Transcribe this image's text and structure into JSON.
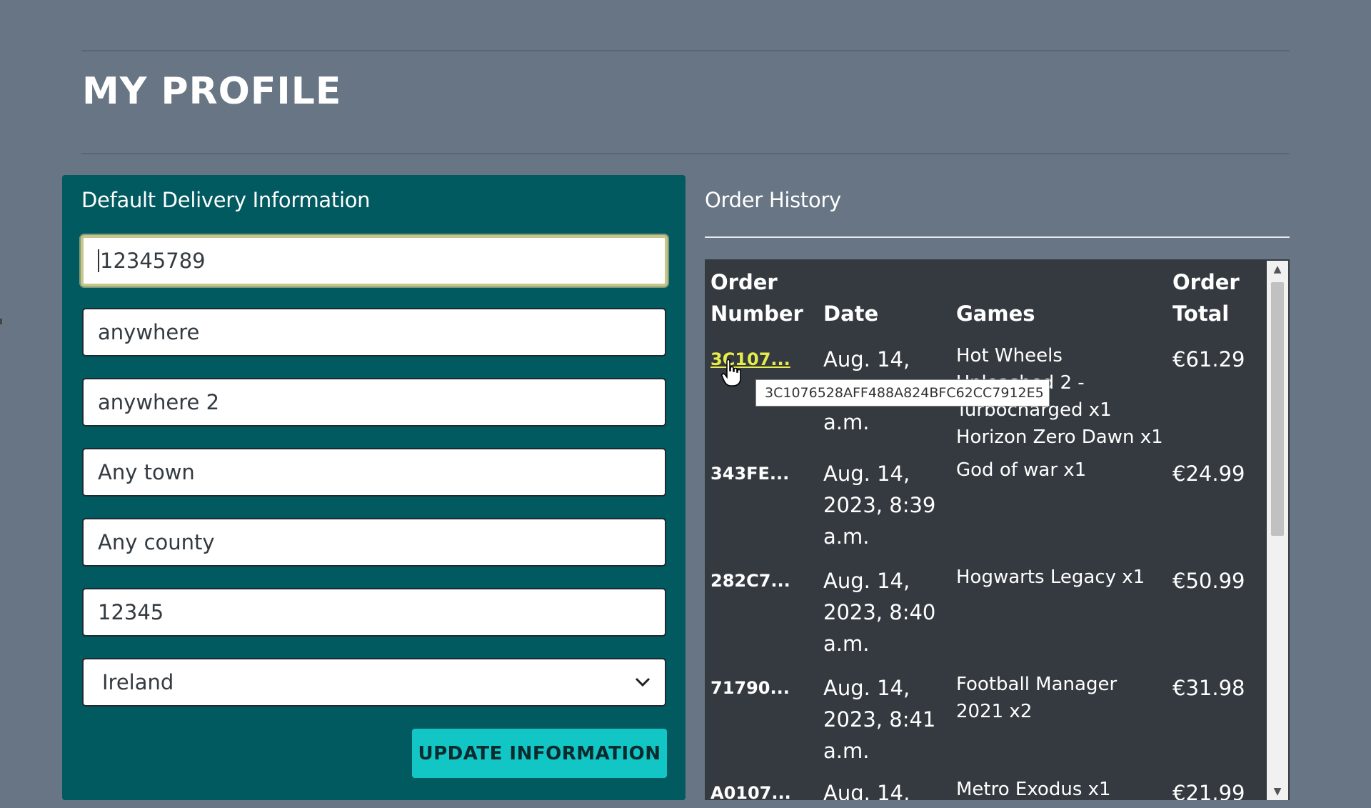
{
  "page": {
    "title": "MY PROFILE"
  },
  "delivery": {
    "heading": "Default Delivery Information",
    "phone": "12345789",
    "street1": "anywhere",
    "street2": "anywhere 2",
    "town": "Any town",
    "county": "Any county",
    "postcode": "12345",
    "country": "Ireland",
    "update_label": "UPDATE INFORMATION"
  },
  "history": {
    "heading": "Order History",
    "headers": {
      "order_number_1": "Order",
      "order_number_2": "Number",
      "date": "Date",
      "games": "Games",
      "total_1": "Order",
      "total_2": "Total"
    },
    "orders": [
      {
        "number": "3C107...",
        "date": "Aug. 14, 2023, 8:38 a.m.",
        "games": "Hot Wheels Unleashed 2 - Turbocharged x1 Horizon Zero Dawn x1",
        "total": "€61.29"
      },
      {
        "number": "343FE...",
        "date": "Aug. 14, 2023, 8:39 a.m.",
        "games": "God of war x1",
        "total": "€24.99"
      },
      {
        "number": "282C7...",
        "date": "Aug. 14, 2023, 8:40 a.m.",
        "games": "Hogwarts Legacy x1",
        "total": "€50.99"
      },
      {
        "number": "71790...",
        "date": "Aug. 14, 2023, 8:41 a.m.",
        "games": "Football Manager 2021 x2",
        "total": "€31.98"
      },
      {
        "number": "A0107...",
        "date": "Aug. 14,",
        "games": "Metro Exodus x1",
        "total": "€21.99"
      }
    ],
    "tooltip": "3C1076528AFF488A824BFC62CC7912E5"
  },
  "icons": {
    "cursor": "hand-pointer-icon",
    "select": "chevron-down-icon",
    "scroll_up": "triangle-up-icon",
    "scroll_down": "triangle-down-icon"
  },
  "colors": {
    "background": "#687584",
    "panel": "#015a60",
    "button": "#11c6c4",
    "table": "#343a40",
    "link": "#e8ec4a"
  }
}
